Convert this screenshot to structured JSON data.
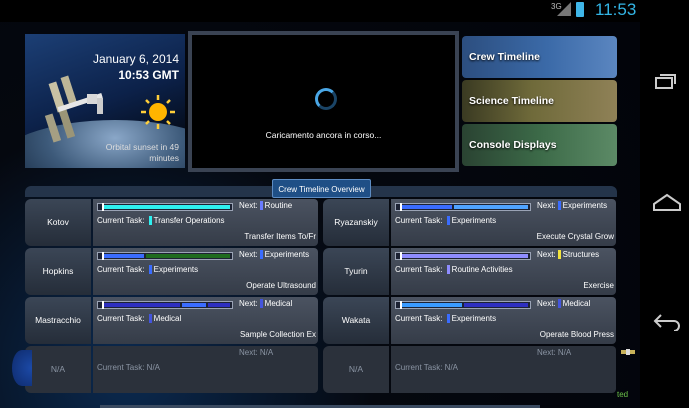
{
  "status": {
    "network": "3G",
    "clock": "11:53"
  },
  "header": {
    "date": "January 6, 2014",
    "time": "10:53 GMT",
    "sunset_note": "Orbital sunset in 49 minutes"
  },
  "video": {
    "loading_text": "Caricamento ancora in corso..."
  },
  "nav_tiles": [
    {
      "label": "Crew Timeline"
    },
    {
      "label": "Science Timeline"
    },
    {
      "label": "Console Displays"
    }
  ],
  "overview_tab": {
    "label": "Crew Timeline Overview"
  },
  "crew": [
    {
      "name": "Kotov",
      "next_label": "Next:",
      "next": "Routine",
      "next_color": "#6a7cff",
      "current_label": "Current Task:",
      "current": "Transfer Operations",
      "current_color": "#2ef0f0",
      "subtask": "Transfer Items To/Fr"
    },
    {
      "name": "Ryazanskiy",
      "next_label": "Next:",
      "next": "Experiments",
      "next_color": "#3a6cff",
      "current_label": "Current Task:",
      "current": "Experiments",
      "current_color": "#3a6cff",
      "subtask": "Execute Crystal Grow"
    },
    {
      "name": "Hopkins",
      "next_label": "Next:",
      "next": "Experiments",
      "next_color": "#3a6cff",
      "current_label": "Current Task:",
      "current": "Experiments",
      "current_color": "#3a6cff",
      "subtask": "Operate Ultrasound"
    },
    {
      "name": "Tyurin",
      "next_label": "Next:",
      "next": "Structures",
      "next_color": "#f2e33c",
      "current_label": "Current Task:",
      "current": "Routine Activities",
      "current_color": "#8e8cff",
      "subtask": "Exercise"
    },
    {
      "name": "Mastracchio",
      "next_label": "Next:",
      "next": "Medical",
      "next_color": "#4455dd",
      "current_label": "Current Task:",
      "current": "Medical",
      "current_color": "#4455dd",
      "subtask": "Sample Collection Ex"
    },
    {
      "name": "Wakata",
      "next_label": "Next:",
      "next": "Medical",
      "next_color": "#4455dd",
      "current_label": "Current Task:",
      "current": "Experiments",
      "current_color": "#3a6cff",
      "subtask": "Operate Blood Press"
    },
    {
      "name": "N/A",
      "next_label": "Next:",
      "next": "N/A",
      "next_color": "",
      "current_label": "Current Task:",
      "current": "N/A",
      "current_color": "",
      "subtask": ""
    },
    {
      "name": "N/A",
      "next_label": "Next:",
      "next": "N/A",
      "next_color": "",
      "current_label": "Current Task:",
      "current": "N/A",
      "current_color": "",
      "subtask": ""
    }
  ],
  "partial_text": {
    "right_edge": "ted"
  },
  "colors": {
    "accent": "#33b5e5",
    "tile_blue": "#3b6aa8",
    "overview_tab": "#1f4f86"
  }
}
